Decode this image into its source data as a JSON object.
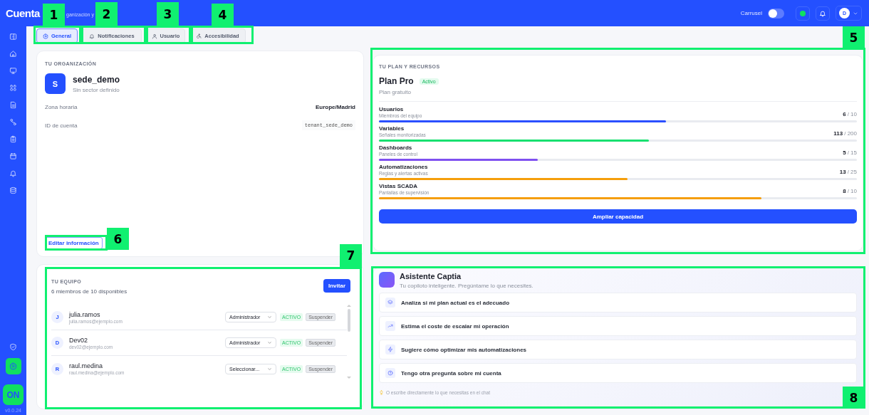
{
  "header": {
    "title": "Cuenta",
    "subtitle": "ganización y",
    "carousel": {
      "label": "Carrusel",
      "on": false
    },
    "status": {
      "color": "#10e060"
    },
    "avatar": "D"
  },
  "sidebar": {
    "items": [
      {
        "selected": false
      },
      {
        "selected": false
      },
      {
        "selected": false
      },
      {
        "selected": false
      },
      {
        "selected": false
      },
      {
        "selected": false
      },
      {
        "selected": false
      },
      {
        "selected": false
      },
      {
        "selected": false
      },
      {
        "selected": false
      }
    ],
    "bottom": [
      {
        "selected": false
      },
      {
        "selected": true
      }
    ],
    "logo": "ON",
    "version": "v0.0.24"
  },
  "tabs": [
    {
      "label": "General",
      "selected": true
    },
    {
      "label": "Notificaciones",
      "selected": false
    },
    {
      "label": "Usuario",
      "selected": false
    },
    {
      "label": "Accesibilidad",
      "selected": false
    }
  ],
  "organization": {
    "heading": "TU ORGANIZACIÓN",
    "initial": "S",
    "name": "sede_demo",
    "sector": "Sin sector definido",
    "fields": [
      {
        "label": "Zona horaria",
        "value": "Europe/Madrid",
        "kind": "text"
      },
      {
        "label": "ID de cuenta",
        "value": "tenant_sede_demo",
        "kind": "code"
      }
    ],
    "edit_button": "Editar información"
  },
  "team": {
    "heading": "TU EQUIPO",
    "summary": "6 miembros de 10 disponibles",
    "invite_button": "Invitar",
    "members": [
      {
        "initial": "J",
        "name": "julia.ramos",
        "email": "julia.ramos@ejemplo.com",
        "role": "Administrador",
        "status": "ACTIVO",
        "action": "Suspender"
      },
      {
        "initial": "D",
        "name": "Dev02",
        "email": "dev02@ejemplo.com",
        "role": "Administrador",
        "status": "ACTIVO",
        "action": "Suspender"
      },
      {
        "initial": "R",
        "name": "raul.medina",
        "email": "raul.medina@ejemplo.com",
        "role": "Seleccionar...",
        "status": "ACTIVO",
        "action": "Suspender"
      }
    ]
  },
  "plan": {
    "heading": "TU PLAN Y RECURSOS",
    "name": "Plan Pro",
    "badge": "Activo",
    "type": "Plan gratuito",
    "resources": [
      {
        "name": "Usuarios",
        "description": "Miembros del equipo",
        "used": "6",
        "total": "/ 10",
        "level": 0.6,
        "color": "#2a4fff"
      },
      {
        "name": "Variables",
        "description": "Señales monitorizadas",
        "used": "113",
        "total": "/ 200",
        "level": 0.565,
        "color": "#18e070"
      },
      {
        "name": "Dashboards",
        "description": "Paneles de control",
        "used": "5",
        "total": "/ 15",
        "level": 0.333,
        "color": "#8050f0"
      },
      {
        "name": "Automatizaciones",
        "description": "Reglas y alertas activas",
        "used": "13",
        "total": "/ 25",
        "level": 0.52,
        "color": "#f59e0b"
      },
      {
        "name": "Vistas SCADA",
        "description": "Pantallas de supervisión",
        "used": "8",
        "total": "/ 10",
        "level": 0.8,
        "color": "#f59e0b"
      }
    ],
    "upgrade_button": "Ampliar capacidad"
  },
  "assistant": {
    "title": "Asistente Captia",
    "subtitle": "Tu copiloto inteligente. Pregúntame lo que necesites.",
    "suggestions": [
      {
        "text": "Analiza si mi plan actual es el adecuado"
      },
      {
        "text": "Estima el coste de escalar mi operación"
      },
      {
        "text": "Sugiere cómo optimizar mis automatizaciones"
      },
      {
        "text": "Tengo otra pregunta sobre mi cuenta"
      }
    ],
    "hint": "O escribe directamente lo que necesitas en el chat"
  },
  "annotations": [
    {
      "label": "1"
    },
    {
      "label": "2"
    },
    {
      "label": "3"
    },
    {
      "label": "4"
    },
    {
      "label": "5"
    },
    {
      "label": "6"
    },
    {
      "label": "7"
    },
    {
      "label": "8"
    }
  ]
}
